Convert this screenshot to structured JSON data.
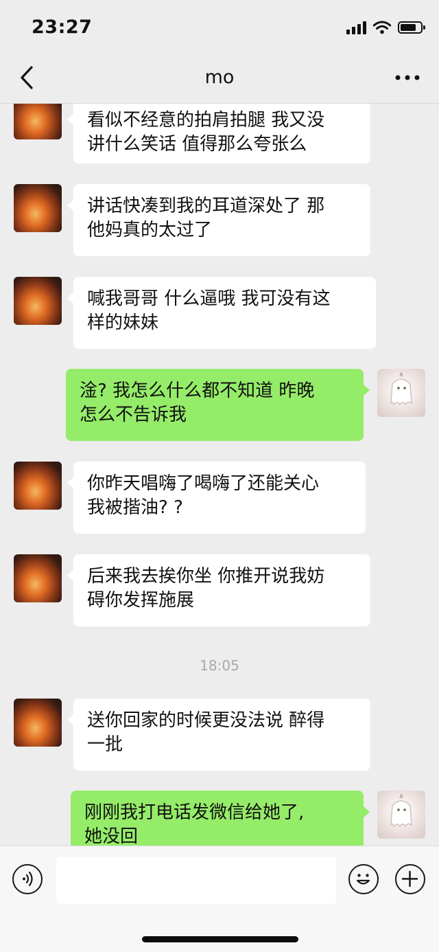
{
  "status_bar": {
    "time": "23:27",
    "battery_level": 0.8
  },
  "header": {
    "title": "mo",
    "back_icon": "chevron-left-icon",
    "more_icon": "more-dots-icon"
  },
  "messages": [
    {
      "sender": "them",
      "text": "看似不经意的拍肩拍腿 我又没\n讲什么笑话 值得那么夸张么"
    },
    {
      "sender": "them",
      "text": "讲话快凑到我的耳道深处了 那\n他妈真的太过了"
    },
    {
      "sender": "them",
      "text": "喊我哥哥 什么逼哦 我可没有这\n样的妹妹"
    },
    {
      "sender": "me",
      "text": "淦? 我怎么什么都不知道 昨晚\n怎么不告诉我"
    },
    {
      "sender": "them",
      "text": "你昨天唱嗨了喝嗨了还能关心\n我被揩油? ?"
    },
    {
      "sender": "them",
      "text": "后来我去挨你坐 你推开说我妨\n碍你发挥施展"
    },
    {
      "sender": "them",
      "text": "送你回家的时候更没法说 醉得\n一批"
    },
    {
      "sender": "me",
      "text": "刚刚我打电话发微信给她了,\n她没回"
    }
  ],
  "timestamp": "18:05",
  "input_bar": {
    "voice_icon": "voice-icon",
    "emoji_icon": "emoji-icon",
    "plus_icon": "plus-icon",
    "input_value": ""
  }
}
